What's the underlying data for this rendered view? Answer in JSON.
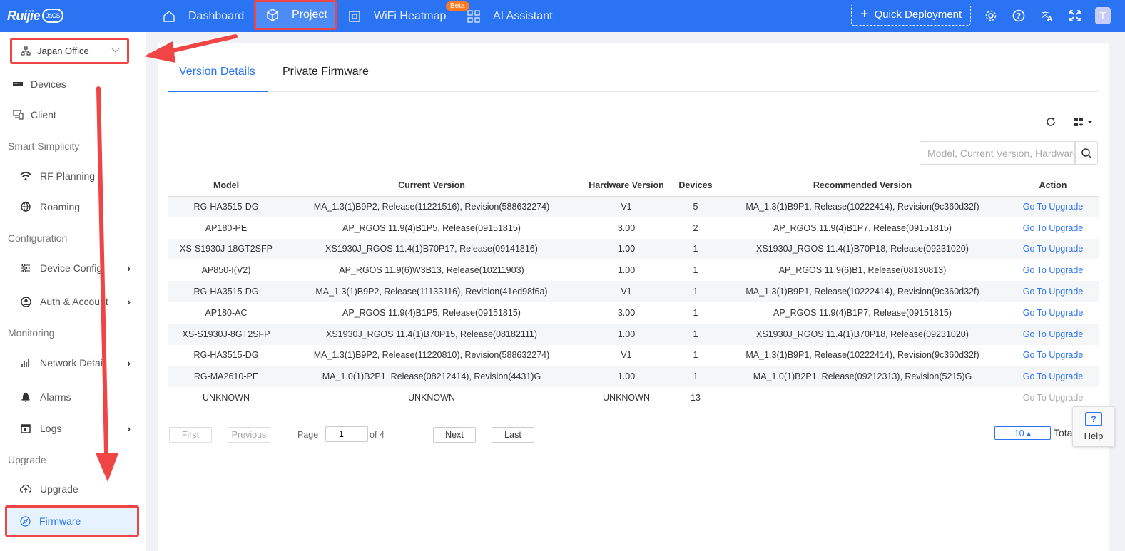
{
  "brand": {
    "logo_text": "Ruijie",
    "cloud_text": "JaCS"
  },
  "topnav": {
    "items": [
      {
        "label": "Dashboard",
        "icon": "home-icon"
      },
      {
        "label": "Project",
        "icon": "cube-icon"
      },
      {
        "label": "WiFi Heatmap",
        "icon": "heatmap-icon",
        "badge": "Beta"
      },
      {
        "label": "AI Assistant",
        "icon": "grid-icon"
      }
    ],
    "quick_deployment": "Quick Deployment",
    "avatar": "T"
  },
  "sidebar": {
    "site": "Japan Office",
    "items": {
      "devices": "Devices",
      "client": "Client",
      "rf_planning": "RF Planning",
      "roaming": "Roaming",
      "device_config": "Device Config",
      "auth_account": "Auth & Account",
      "network_details": "Network Details",
      "alarms": "Alarms",
      "logs": "Logs",
      "upgrade": "Upgrade",
      "firmware": "Firmware"
    },
    "groups": {
      "smart_simplicity": "Smart Simplicity",
      "configuration": "Configuration",
      "monitoring": "Monitoring",
      "upgrade": "Upgrade"
    }
  },
  "tabs": {
    "version_details": "Version Details",
    "private_firmware": "Private Firmware"
  },
  "search": {
    "placeholder": "Model, Current Version, Hardware Version"
  },
  "table": {
    "headers": {
      "model": "Model",
      "current": "Current Version",
      "hardware": "Hardware Version",
      "devices": "Devices",
      "recommended": "Recommended Version",
      "action": "Action"
    },
    "rows": [
      {
        "model": "RG-HA3515-DG",
        "current": "MA_1.3(1)B9P2, Release(11221516), Revision(588632274)",
        "hardware": "V1",
        "devices": "5",
        "recommended": "MA_1.3(1)B9P1, Release(10222414), Revision(9c360d32f)",
        "action": "Go To Upgrade"
      },
      {
        "model": "AP180-PE",
        "current": "AP_RGOS 11.9(4)B1P5, Release(09151815)",
        "hardware": "3.00",
        "devices": "2",
        "recommended": "AP_RGOS 11.9(4)B1P7, Release(09151815)",
        "action": "Go To Upgrade"
      },
      {
        "model": "XS-S1930J-18GT2SFP",
        "current": "XS1930J_RGOS 11.4(1)B70P17, Release(09141816)",
        "hardware": "1.00",
        "devices": "1",
        "recommended": "XS1930J_RGOS 11.4(1)B70P18, Release(09231020)",
        "action": "Go To Upgrade"
      },
      {
        "model": "AP850-I(V2)",
        "current": "AP_RGOS 11.9(6)W3B13, Release(10211903)",
        "hardware": "1.00",
        "devices": "1",
        "recommended": "AP_RGOS 11.9(6)B1, Release(08130813)",
        "action": "Go To Upgrade"
      },
      {
        "model": "RG-HA3515-DG",
        "current": "MA_1.3(1)B9P2, Release(11133116), Revision(41ed98f6a)",
        "hardware": "V1",
        "devices": "1",
        "recommended": "MA_1.3(1)B9P1, Release(10222414), Revision(9c360d32f)",
        "action": "Go To Upgrade"
      },
      {
        "model": "AP180-AC",
        "current": "AP_RGOS 11.9(4)B1P5, Release(09151815)",
        "hardware": "3.00",
        "devices": "1",
        "recommended": "AP_RGOS 11.9(4)B1P7, Release(09151815)",
        "action": "Go To Upgrade"
      },
      {
        "model": "XS-S1930J-8GT2SFP",
        "current": "XS1930J_RGOS 11.4(1)B70P15, Release(08182111)",
        "hardware": "1.00",
        "devices": "1",
        "recommended": "XS1930J_RGOS 11.4(1)B70P18, Release(09231020)",
        "action": "Go To Upgrade"
      },
      {
        "model": "RG-HA3515-DG",
        "current": "MA_1.3(1)B9P2, Release(11220810), Revision(588632274)",
        "hardware": "V1",
        "devices": "1",
        "recommended": "MA_1.3(1)B9P1, Release(10222414), Revision(9c360d32f)",
        "action": "Go To Upgrade"
      },
      {
        "model": "RG-MA2610-PE",
        "current": "MA_1.0(1)B2P1, Release(08212414), Revision(4431)G",
        "hardware": "1.00",
        "devices": "1",
        "recommended": "MA_1.0(1)B2P1, Release(09212313), Revision(5215)G",
        "action": "Go To Upgrade"
      },
      {
        "model": "UNKNOWN",
        "current": "UNKNOWN",
        "hardware": "UNKNOWN",
        "devices": "13",
        "recommended": "-",
        "action": "Go To Upgrade",
        "disabled": true
      }
    ]
  },
  "pagination": {
    "first": "First",
    "previous": "Previous",
    "page_label": "Page",
    "page_value": "1",
    "of_label": "of 4",
    "next": "Next",
    "last": "Last",
    "page_size": "10 ▴",
    "total_label": "Total"
  },
  "help": {
    "label": "Help"
  },
  "colors": {
    "primary": "#2a73f3",
    "annotation": "#f04545"
  }
}
